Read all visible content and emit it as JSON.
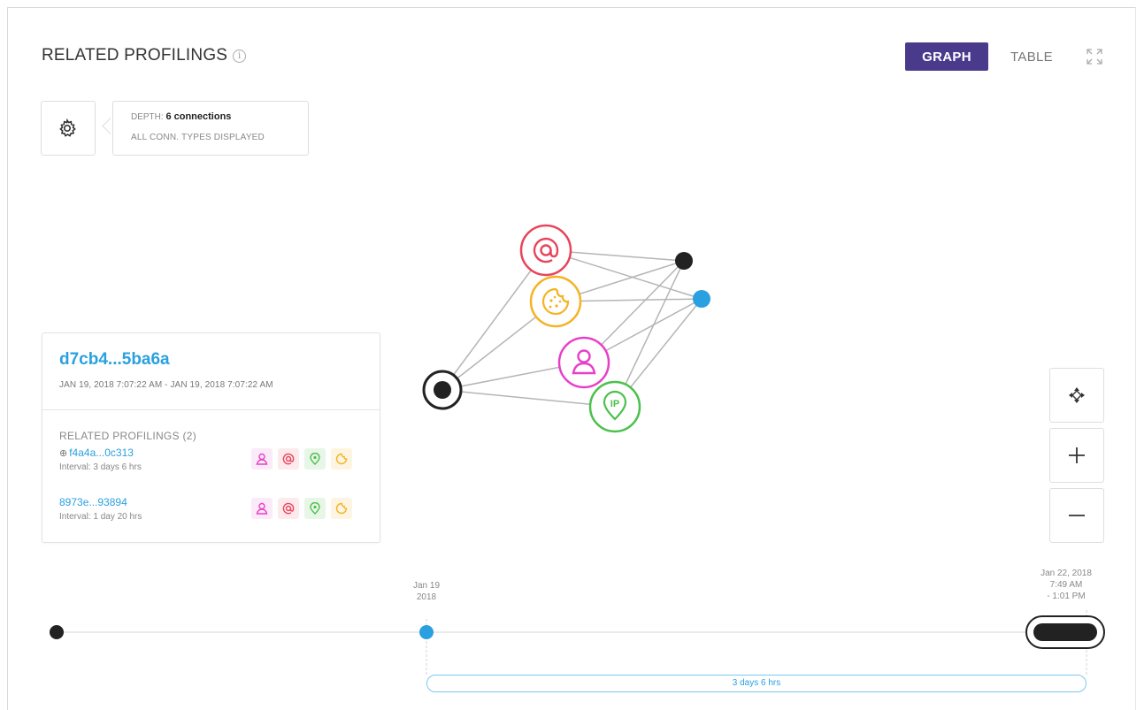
{
  "header": {
    "title": "RELATED PROFILINGS",
    "info_icon": "info-icon",
    "graph_label": "GRAPH",
    "table_label": "TABLE",
    "expand_icon": "expand-icon",
    "active_tab": "GRAPH",
    "accent_color": "#4a3a8c"
  },
  "settings": {
    "icon": "gear-icon",
    "depth_prefix": "DEPTH:",
    "depth_value": "6 connections",
    "types_line": "ALL CONN. TYPES DISPLAYED"
  },
  "graph": {
    "nodes": [
      {
        "id": "root",
        "type": "profile-root",
        "icon": "target-icon",
        "color": "#222222"
      },
      {
        "id": "email",
        "type": "email",
        "icon": "at-icon",
        "color": "#e8445a"
      },
      {
        "id": "cookie",
        "type": "cookie",
        "icon": "cookie-icon",
        "color": "#f5b323"
      },
      {
        "id": "user",
        "type": "user",
        "icon": "user-icon",
        "color": "#e83fc8"
      },
      {
        "id": "ip",
        "type": "ip",
        "icon": "ip-pin-icon",
        "color": "#4cc04c"
      },
      {
        "id": "profile-a",
        "type": "profile",
        "color": "#222222"
      },
      {
        "id": "profile-b",
        "type": "profile",
        "color": "#2aa0e0"
      }
    ],
    "edges": [
      [
        "root",
        "email"
      ],
      [
        "root",
        "cookie"
      ],
      [
        "root",
        "user"
      ],
      [
        "root",
        "ip"
      ],
      [
        "email",
        "profile-a"
      ],
      [
        "email",
        "profile-b"
      ],
      [
        "cookie",
        "profile-a"
      ],
      [
        "cookie",
        "profile-b"
      ],
      [
        "user",
        "profile-a"
      ],
      [
        "user",
        "profile-b"
      ],
      [
        "ip",
        "profile-a"
      ],
      [
        "ip",
        "profile-b"
      ]
    ],
    "ip_text": "IP"
  },
  "card": {
    "id": "d7cb4...5ba6a",
    "range": "JAN 19, 2018 7:07:22 AM - JAN 19, 2018 7:07:22 AM",
    "related_heading": "RELATED PROFILINGS (2)",
    "related": [
      {
        "id": "f4a4a...0c313",
        "prefix": "⊕",
        "interval": "Interval: 3 days 6 hrs",
        "tags": [
          "user-icon",
          "at-icon",
          "ip-pin-icon",
          "cookie-icon"
        ]
      },
      {
        "id": "8973e...93894",
        "prefix": "",
        "interval": "Interval: 1 day 20 hrs",
        "tags": [
          "user-icon",
          "at-icon",
          "ip-pin-icon",
          "cookie-icon"
        ]
      }
    ]
  },
  "controls": {
    "center_icon": "move-icon",
    "zoom_in_icon": "plus-icon",
    "zoom_out_icon": "minus-icon"
  },
  "timeline": {
    "start_label_1": "Jan 19",
    "start_label_2": "2018",
    "end_label_1": "Jan 22, 2018",
    "end_label_2": "7:49 AM",
    "end_label_3": "- 1:01 PM",
    "interval": "3 days 6 hrs"
  }
}
